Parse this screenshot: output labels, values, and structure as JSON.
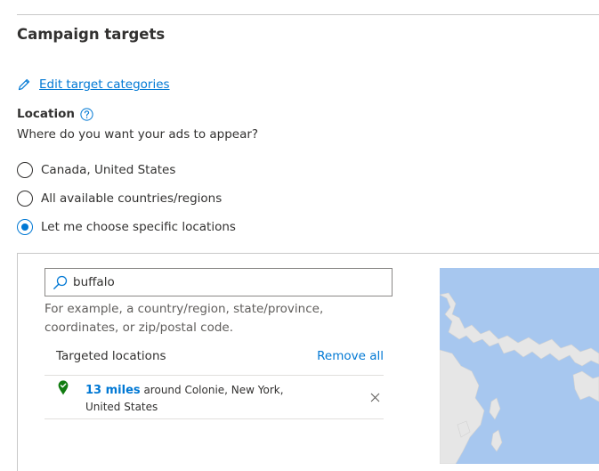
{
  "section": {
    "title": "Campaign targets"
  },
  "edit_link": {
    "icon": "pencil-icon",
    "label": "Edit target categories"
  },
  "location": {
    "label": "Location",
    "help_icon": "help-icon",
    "question": "Where do you want your ads to appear?"
  },
  "radio_options": [
    {
      "label": "Canada, United States",
      "selected": false
    },
    {
      "label": "All available countries/regions",
      "selected": false
    },
    {
      "label": "Let me choose specific locations",
      "selected": true
    }
  ],
  "search": {
    "value": "buffalo",
    "icon": "search-icon"
  },
  "hint": "For example, a country/region, state/province, coordinates, or zip/postal code.",
  "targeted": {
    "title": "Targeted locations",
    "remove_all": "Remove all",
    "items": [
      {
        "radius": "13 miles",
        "text": " around Colonie, New York, United States",
        "icon": "location-pin-icon"
      }
    ]
  },
  "colors": {
    "accent": "#0078d4",
    "pin": "#107c10",
    "map_water": "#a7c7ef",
    "map_land": "#e6e6e6"
  }
}
